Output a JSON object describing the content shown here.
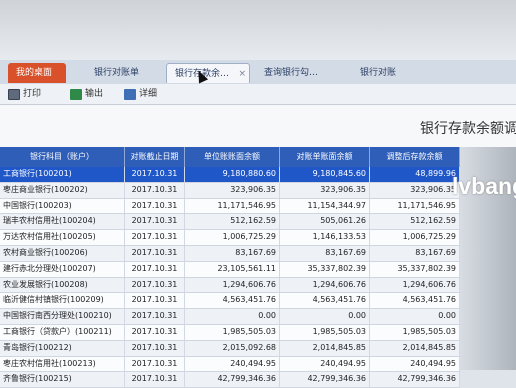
{
  "tabs": {
    "home": "我的桌面",
    "t1": "银行对账单",
    "t2": "银行存款余…",
    "t2_close": "×",
    "t3": "查询银行勾…",
    "t4": "银行对账"
  },
  "toolbar": {
    "print": "打印",
    "export": "输出",
    "detail": "详细"
  },
  "report_title": "银行存款余额调节",
  "columns": [
    "银行科目（账户）",
    "对账截止日期",
    "单位账账面余额",
    "对账单账面余额",
    "调整后存款余额"
  ],
  "rows": [
    [
      "工商银行(100201)",
      "2017.10.31",
      "9,180,880.60",
      "9,180,845.60",
      "48,899.96"
    ],
    [
      "枣庄商业银行(100202)",
      "2017.10.31",
      "323,906.35",
      "323,906.35",
      "323,906.35"
    ],
    [
      "中国银行(100203)",
      "2017.10.31",
      "11,171,546.95",
      "11,154,344.97",
      "11,171,546.95"
    ],
    [
      "瑞丰农村信用社(100204)",
      "2017.10.31",
      "512,162.59",
      "505,061.26",
      "512,162.59"
    ],
    [
      "万达农村信用社(100205)",
      "2017.10.31",
      "1,006,725.29",
      "1,146,133.53",
      "1,006,725.29"
    ],
    [
      "农村商业银行(100206)",
      "2017.10.31",
      "83,167.69",
      "83,167.69",
      "83,167.69"
    ],
    [
      "建行赤北分理处(100207)",
      "2017.10.31",
      "23,105,561.11",
      "35,337,802.39",
      "35,337,802.39"
    ],
    [
      "农业发展银行(100208)",
      "2017.10.31",
      "1,294,606.76",
      "1,294,606.76",
      "1,294,606.76"
    ],
    [
      "临沂健信村镇银行(100209)",
      "2017.10.31",
      "4,563,451.76",
      "4,563,451.76",
      "4,563,451.76"
    ],
    [
      "中国银行南西分理处(100210)",
      "2017.10.31",
      "0.00",
      "0.00",
      "0.00"
    ],
    [
      "工商银行（贷款户）(100211)",
      "2017.10.31",
      "1,985,505.03",
      "1,985,505.03",
      "1,985,505.03"
    ],
    [
      "青岛银行(100212)",
      "2017.10.31",
      "2,015,092.68",
      "2,014,845.85",
      "2,014,845.85"
    ],
    [
      "枣庄农村信用社(100213)",
      "2017.10.31",
      "240,494.95",
      "240,494.95",
      "240,494.95"
    ],
    [
      "齐鲁银行(100215)",
      "2017.10.31",
      "42,799,346.36",
      "42,799,346.36",
      "42,799,346.36"
    ]
  ],
  "watermark": "lvbang",
  "colors": {
    "header_bg": "#2f5eb8",
    "selected_row": "#1f57c9",
    "home_tab": "#d9512a"
  }
}
